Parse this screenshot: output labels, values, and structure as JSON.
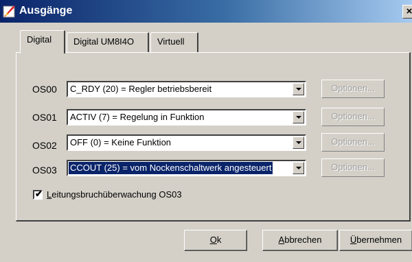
{
  "window": {
    "title": "Ausgänge",
    "close_label": "×"
  },
  "tabs": [
    {
      "label": "Digital",
      "active": true
    },
    {
      "label": "Digital UM8I4O",
      "active": false
    },
    {
      "label": "Virtuell",
      "active": false
    }
  ],
  "rows": [
    {
      "label": "OS00",
      "value": "C_RDY (20) = Regler betriebsbereit",
      "options_label": "Optionen...",
      "options_enabled": false
    },
    {
      "label": "OS01",
      "value": "ACTIV (7) = Regelung in Funktion",
      "options_label": "Optionen...",
      "options_enabled": false
    },
    {
      "label": "OS02",
      "value": "OFF (0) = Keine Funktion",
      "options_label": "Optionen...",
      "options_enabled": false
    },
    {
      "label": "OS03",
      "value": "CCOUT (25) = vom Nockenschaltwerk angesteuert",
      "options_label": "Optionen...",
      "options_enabled": false,
      "selected": true
    }
  ],
  "checkbox": {
    "checked": true,
    "mnemonic": "L",
    "label_rest": "eitungsbruchüberwachung OS03"
  },
  "buttons": {
    "ok": {
      "mnemonic": "O",
      "rest": "k"
    },
    "cancel": {
      "mnemonic": "A",
      "rest": "bbrechen"
    },
    "apply": {
      "mnemonic": "Ü",
      "rest": "bernehmen"
    }
  },
  "colors": {
    "titlebar_start": "#0a246a",
    "titlebar_end": "#a6caf0",
    "face": "#d4d0c8",
    "selection": "#0a246a"
  }
}
